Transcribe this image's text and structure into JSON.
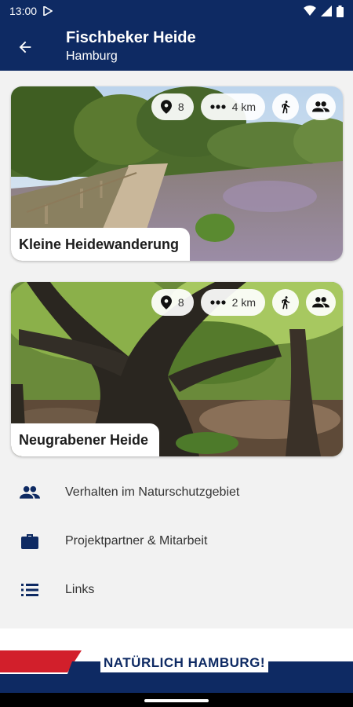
{
  "status_bar": {
    "time": "13:00",
    "icons": [
      "play-store-icon",
      "wifi-icon",
      "signal-icon",
      "battery-icon"
    ]
  },
  "app_bar": {
    "title": "Fischbeker Heide",
    "subtitle": "Hamburg",
    "back_icon": "arrow-back-icon"
  },
  "tours": [
    {
      "name": "Kleine Heidewanderung",
      "station_count": "8",
      "distance": "4 km",
      "mode_icon": "walking-person-icon",
      "group_icon": "group-icon"
    },
    {
      "name": "Neugrabener Heide",
      "station_count": "8",
      "distance": "2 km",
      "mode_icon": "walking-person-icon",
      "group_icon": "group-icon"
    }
  ],
  "menu": [
    {
      "label": "Verhalten im Naturschutzgebiet",
      "icon": "people-icon"
    },
    {
      "label": "Projektpartner & Mitarbeit",
      "icon": "briefcase-icon"
    },
    {
      "label": "Links",
      "icon": "list-icon"
    }
  ],
  "footer": {
    "slogan": "NATÜRLICH HAMBURG!"
  },
  "colors": {
    "primary": "#0e2a63",
    "accent_red": "#d21f2b",
    "background": "#f2f2f2"
  }
}
